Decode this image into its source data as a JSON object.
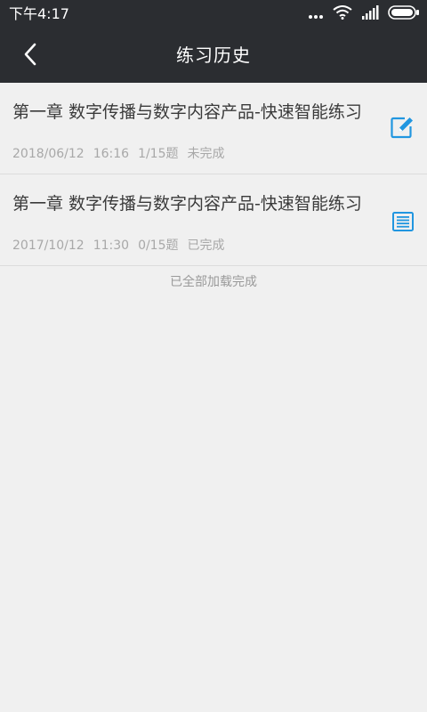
{
  "status_bar": {
    "time": "下午4:17"
  },
  "header": {
    "title": "练习历史"
  },
  "history": [
    {
      "title": "第一章 数字传播与数字内容产品-快速智能练习",
      "date": "2018/06/12",
      "time": "16:16",
      "progress": "1/15题",
      "status": "未完成",
      "icon": "edit-icon"
    },
    {
      "title": "第一章 数字传播与数字内容产品-快速智能练习",
      "date": "2017/10/12",
      "time": "11:30",
      "progress": "0/15题",
      "status": "已完成",
      "icon": "report-icon"
    }
  ],
  "footer": {
    "text": "已全部加载完成"
  },
  "colors": {
    "header_bg": "#2b2d31",
    "accent": "#2196e0",
    "page_bg": "#f0f0f0"
  }
}
